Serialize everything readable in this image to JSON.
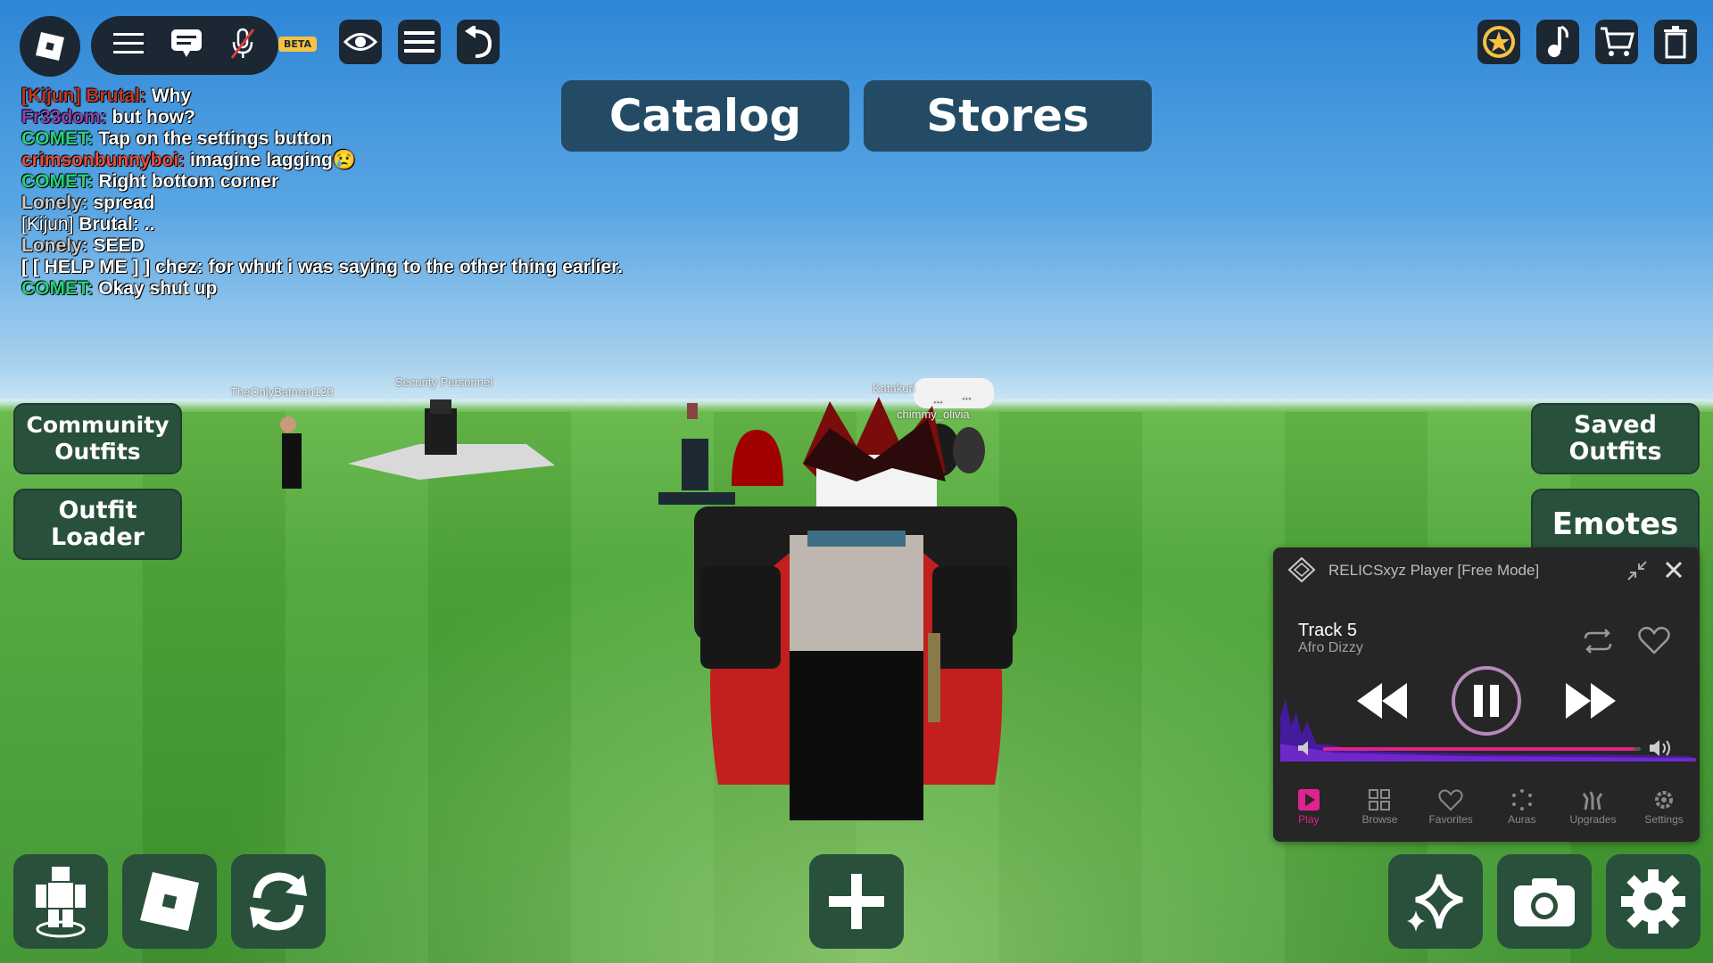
{
  "top_bar": {
    "beta_badge": "BETA",
    "left_icons": [
      "roblox-logo-icon",
      "menu-icon",
      "chat-icon",
      "mic-muted-icon",
      "eye-icon",
      "list-icon",
      "undo-icon"
    ],
    "right_icons": [
      "premium-star-icon",
      "music-icon",
      "cart-icon",
      "trash-icon"
    ]
  },
  "tabs": {
    "catalog": "Catalog",
    "stores": "Stores"
  },
  "chat": {
    "lines": [
      {
        "name": "[Kijun] Brutal:",
        "text": " Why",
        "color": "#c0392b"
      },
      {
        "name": "Fr33dom:",
        "text": " but how?",
        "color": "#8e44ad"
      },
      {
        "name": "COMET:",
        "text": " Tap on the settings button",
        "color": "#27d17a"
      },
      {
        "name": "crimsonbunnyboi:",
        "text": " imagine lagging😢",
        "color": "#e74c3c"
      },
      {
        "name": "COMET:",
        "text": " Right bottom corner",
        "color": "#27d17a"
      },
      {
        "name": "Lonely:",
        "text": " spread",
        "color": "#c8c8c8"
      },
      {
        "name": "[Kijun]",
        "text": " Brutal: ..",
        "color": "#ffffff"
      },
      {
        "name": "Lonely:",
        "text": " SEED",
        "color": "#c8c8c8"
      },
      {
        "name": "[ [ HELP ME ] ]",
        "text": " chez: for whut i was saying to the other thing earlier.",
        "color": "#ffffff"
      },
      {
        "name": "COMET:",
        "text": " Okay shut up",
        "color": "#27d17a"
      }
    ]
  },
  "left_buttons": {
    "community_outfits": "Community\nOutfits",
    "outfit_loader": "Outfit\nLoader"
  },
  "right_buttons": {
    "saved_outfits": "Saved\nOutfits",
    "emotes": "Emotes"
  },
  "nametags": {
    "batman": "TheOnlyBatman120",
    "security": "Security Personnel",
    "katakuri": "Katakuri",
    "olivia": "chimmy_olivia",
    "bubble1": "...",
    "bubble2": "..."
  },
  "player": {
    "title": "RELICSxyz Player [Free Mode]",
    "track_name": "Track 5",
    "artist": "Afro Dizzy",
    "volume_fraction": 0.98,
    "accent": "#e0228e",
    "nav": [
      {
        "label": "Play",
        "icon": "play-icon",
        "active": true
      },
      {
        "label": "Browse",
        "icon": "browse-icon",
        "active": false
      },
      {
        "label": "Favorites",
        "icon": "heart-icon",
        "active": false
      },
      {
        "label": "Auras",
        "icon": "auras-icon",
        "active": false
      },
      {
        "label": "Upgrades",
        "icon": "upgrades-icon",
        "active": false
      },
      {
        "label": "Settings",
        "icon": "settings-icon",
        "active": false
      }
    ]
  },
  "bottom_buttons": {
    "left_icons": [
      "avatar-icon",
      "roblox-icon",
      "refresh-icon"
    ],
    "center_icon": "plus-icon",
    "right_icons": [
      "sparkle-icon",
      "camera-icon",
      "gear-icon"
    ]
  },
  "colors": {
    "button_green": "#29503b",
    "tab_blue": "#234b66",
    "topbar_dark": "#1b2733"
  }
}
